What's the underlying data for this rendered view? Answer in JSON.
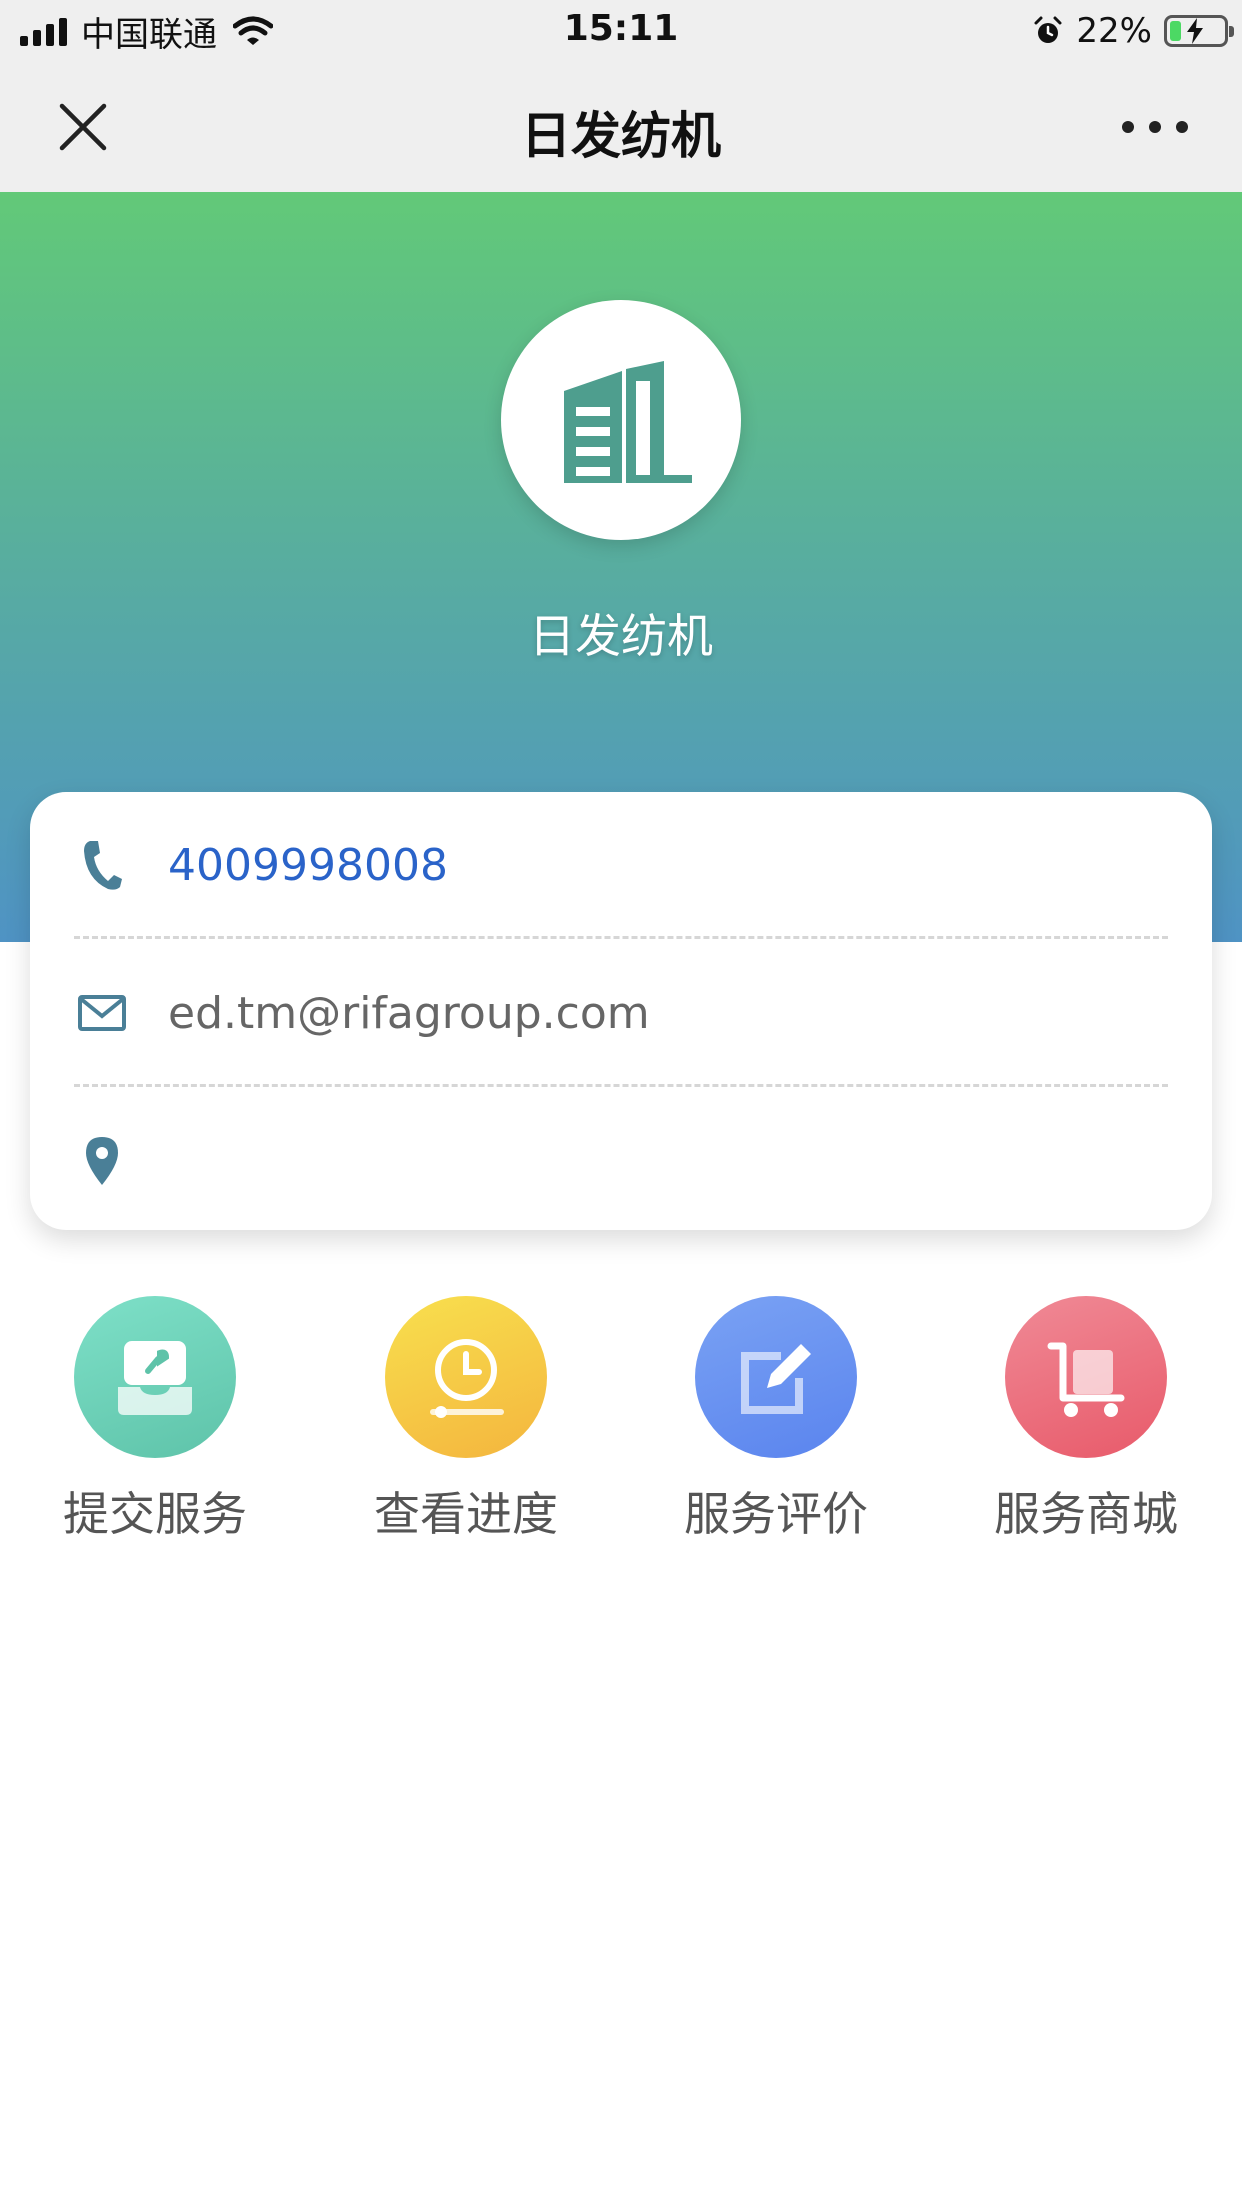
{
  "status_bar": {
    "carrier": "中国联通",
    "time": "15:11",
    "battery_percent": "22%",
    "battery_level": 0.22
  },
  "nav": {
    "title": "日发纺机"
  },
  "header": {
    "company_name": "日发纺机",
    "gradient_colors": [
      "#62c978",
      "#4f93c4"
    ]
  },
  "contact": {
    "phone": "4009998008",
    "email": "ed.tm@rifagroup.com",
    "address": ""
  },
  "menu": {
    "items": [
      {
        "label": "提交服务",
        "icon": "service-desk-icon"
      },
      {
        "label": "查看进度",
        "icon": "clock-progress-icon"
      },
      {
        "label": "服务评价",
        "icon": "edit-review-icon"
      },
      {
        "label": "服务商城",
        "icon": "cart-icon"
      }
    ]
  }
}
